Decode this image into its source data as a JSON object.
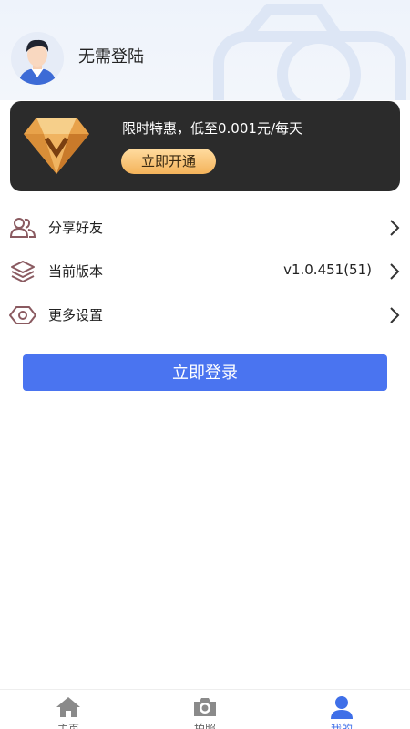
{
  "profile": {
    "username": "无需登陆"
  },
  "vip": {
    "promo_text": "限时特惠，低至0.001元/每天",
    "cta_label": "立即开通"
  },
  "menu": [
    {
      "label": "分享好友",
      "value": "",
      "icon": "users-icon"
    },
    {
      "label": "当前版本",
      "value": "v1.0.451(51)",
      "icon": "layers-icon"
    },
    {
      "label": "更多设置",
      "value": "",
      "icon": "settings-hexagon-icon"
    }
  ],
  "login": {
    "label": "立即登录"
  },
  "tabbar": {
    "tabs": [
      {
        "label": "主页",
        "icon": "home-icon"
      },
      {
        "label": "拍照",
        "icon": "camera-icon"
      },
      {
        "label": "我的",
        "icon": "user-icon"
      }
    ],
    "active_index": 2
  },
  "colors": {
    "accent": "#4a74f0",
    "vip_card": "#2b2b2b",
    "vip_button": "#f4b35a"
  }
}
